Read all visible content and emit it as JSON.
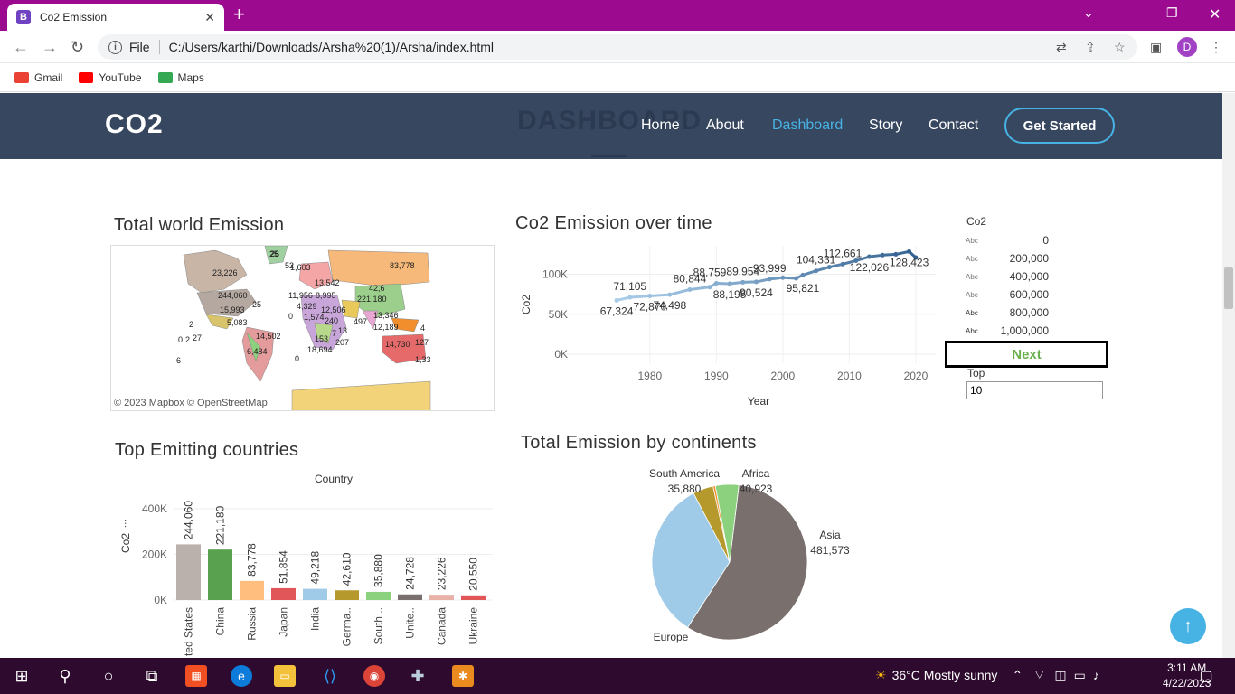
{
  "browser": {
    "tab_title": "Co2 Emission",
    "tab_favicon": "B",
    "url_scheme": "File",
    "url": "C:/Users/karthi/Downloads/Arsha%20(1)/Arsha/index.html",
    "profile_initial": "D",
    "bookmarks": [
      {
        "label": "Gmail",
        "color": "#ea4335"
      },
      {
        "label": "YouTube",
        "color": "#ff0000"
      },
      {
        "label": "Maps",
        "color": "#34a853"
      }
    ]
  },
  "site": {
    "logo": "CO2",
    "ghost_heading": "DASHBOARD",
    "nav": [
      {
        "label": "Home",
        "active": false
      },
      {
        "label": "About",
        "active": false
      },
      {
        "label": "Dashboard",
        "active": true
      },
      {
        "label": "Story",
        "active": false
      },
      {
        "label": "Contact",
        "active": false
      }
    ],
    "cta": "Get Started"
  },
  "dashboard": {
    "map": {
      "title": "Total world Emission",
      "attribution": "© 2023 Mapbox  © OpenStreetMap",
      "labels": [
        "23,226",
        "25",
        "244,060",
        "15,993",
        "25",
        "2",
        "0",
        "2",
        "27",
        "6",
        "5,083",
        "14,502",
        "6,484",
        "0",
        "1,603",
        "83,778",
        "221,180",
        "13,542",
        "42,6",
        "4,329",
        "11,956",
        "8,995",
        "12,506",
        "13,346",
        "1,574",
        "240",
        "497",
        "12,189",
        "14,730",
        "4",
        "1,33",
        "127",
        "153",
        "207",
        "18,694",
        "13",
        "7",
        "0",
        "52",
        "26"
      ]
    },
    "line": {
      "title": "Co2 Emission over time",
      "ylabel": "Co2",
      "xlabel": "Year",
      "yticks": [
        "100K",
        "50K",
        "0K"
      ],
      "xticks": [
        "1980",
        "1990",
        "2000",
        "2010",
        "2020"
      ]
    },
    "legend": {
      "title": "Co2",
      "glyph": "Abc",
      "items": [
        "0",
        "200,000",
        "400,000",
        "600,000",
        "800,000",
        "1,000,000"
      ],
      "colors": [
        "#dde9f2",
        "#c5d9ea",
        "#a7c6e0",
        "#85aed3",
        "#5f8fbd",
        "#2f5f8f"
      ]
    },
    "next_button": "Next",
    "top_label": "Top",
    "top_value": "10",
    "bar": {
      "title": "Top Emitting countries",
      "header": "Country",
      "ylabel": "Co2",
      "yticks": [
        "400K",
        "200K",
        "0K"
      ]
    },
    "pie": {
      "title": "Total Emission by continents"
    }
  },
  "chart_data": [
    {
      "type": "line",
      "title": "Co2 Emission over time",
      "xlabel": "Year",
      "ylabel": "Co2",
      "ylim": [
        0,
        130000
      ],
      "xlim": [
        1972,
        2023
      ],
      "x": [
        1975,
        1977,
        1980,
        1983,
        1986,
        1989,
        1990,
        1992,
        1994,
        1996,
        1998,
        2000,
        2002,
        2003,
        2005,
        2007,
        2009,
        2011,
        2013,
        2015,
        2017,
        2019,
        2020
      ],
      "y": [
        67324,
        71105,
        72870,
        74498,
        80844,
        84000,
        88759,
        88195,
        89954,
        90524,
        93999,
        95821,
        95000,
        99000,
        104331,
        109000,
        112661,
        117000,
        122026,
        124000,
        125000,
        128423,
        121000
      ],
      "data_labels": [
        {
          "x": 1975,
          "y": 67324,
          "text": "67,324",
          "pos": "below"
        },
        {
          "x": 1977,
          "y": 71105,
          "text": "71,105",
          "pos": "above"
        },
        {
          "x": 1980,
          "y": 72870,
          "text": "72,870",
          "pos": "below"
        },
        {
          "x": 1983,
          "y": 74498,
          "text": "74,498",
          "pos": "below"
        },
        {
          "x": 1986,
          "y": 80844,
          "text": "80,844",
          "pos": "above"
        },
        {
          "x": 1989,
          "y": 88759,
          "text": "88,759",
          "pos": "above"
        },
        {
          "x": 1992,
          "y": 88195,
          "text": "88,195",
          "pos": "below"
        },
        {
          "x": 1994,
          "y": 89954,
          "text": "89,954",
          "pos": "above"
        },
        {
          "x": 1996,
          "y": 90524,
          "text": "90,524",
          "pos": "below"
        },
        {
          "x": 1998,
          "y": 93999,
          "text": "93,999",
          "pos": "above"
        },
        {
          "x": 2003,
          "y": 95821,
          "text": "95,821",
          "pos": "below"
        },
        {
          "x": 2005,
          "y": 104331,
          "text": "104,331",
          "pos": "above"
        },
        {
          "x": 2009,
          "y": 112661,
          "text": "112,661",
          "pos": "above"
        },
        {
          "x": 2013,
          "y": 122026,
          "text": "122,026",
          "pos": "below"
        },
        {
          "x": 2019,
          "y": 128423,
          "text": "128,423",
          "pos": "below"
        }
      ]
    },
    {
      "type": "bar",
      "title": "Top Emitting countries",
      "xlabel": "Country",
      "ylabel": "Co2",
      "ylim": [
        0,
        420000
      ],
      "categories": [
        "United States",
        "China",
        "Russia",
        "Japan",
        "India",
        "Germa..",
        "South ..",
        "Unite..",
        "Canada",
        "Ukraine"
      ],
      "values": [
        244060,
        221180,
        83778,
        51854,
        49218,
        42610,
        35880,
        24728,
        23226,
        20550
      ],
      "value_labels": [
        "244,060",
        "221,180",
        "83,778",
        "51,854",
        "49,218",
        "42,610",
        "35,880",
        "24,728",
        "23,226",
        "20,550"
      ],
      "colors": [
        "#bab0ac",
        "#59a14f",
        "#ffbe7d",
        "#e15759",
        "#a0cbe8",
        "#b6992d",
        "#8cd17d",
        "#79706e",
        "#e8b2a8",
        "#e15759"
      ]
    },
    {
      "type": "pie",
      "title": "Total Emission by continents",
      "slices": [
        {
          "label": "Asia",
          "value": 481573,
          "value_text": "481,573",
          "color": "#79706e"
        },
        {
          "label": "Europe",
          "value": 280000,
          "value_text": "",
          "color": "#a0cbe8"
        },
        {
          "label": "South America",
          "value": 35880,
          "value_text": "35,880",
          "color": "#b6992d"
        },
        {
          "label": "Africa",
          "value": 40923,
          "value_text": "40,923",
          "color": "#8cd17d"
        },
        {
          "label": "",
          "value": 4000,
          "value_text": "",
          "color": "#f28e2b"
        }
      ]
    }
  ],
  "taskbar": {
    "weather": "36°C  Mostly sunny",
    "time": "3:11 AM",
    "date": "4/22/2023"
  }
}
